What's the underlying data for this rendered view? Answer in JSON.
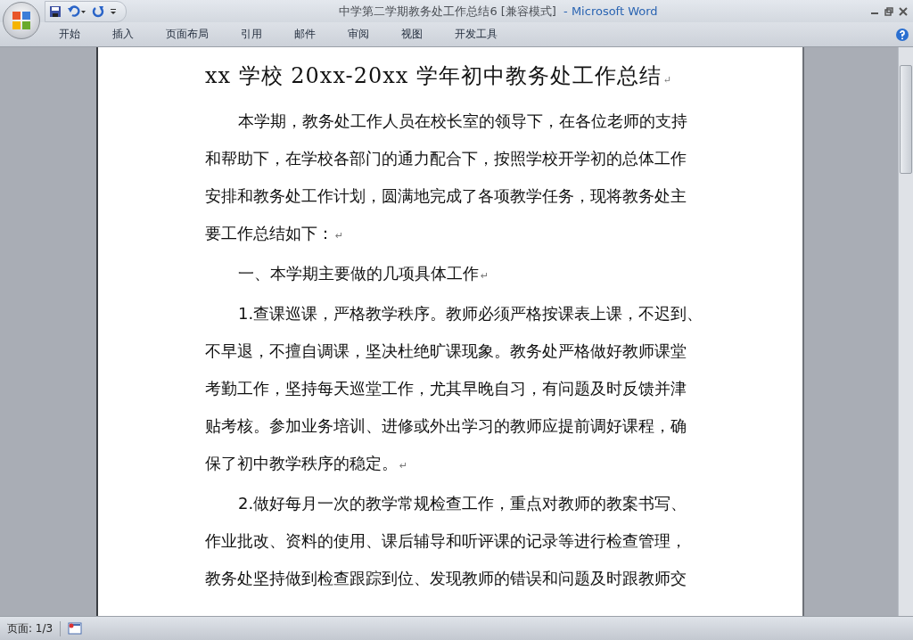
{
  "window": {
    "title": "中学第二学期教务处工作总结6 [兼容模式]",
    "app": "- Microsoft Word"
  },
  "ribbon_tabs": [
    {
      "label": "开始",
      "selected": false
    },
    {
      "label": "插入",
      "selected": false
    },
    {
      "label": "页面布局",
      "selected": false
    },
    {
      "label": "引用",
      "selected": false
    },
    {
      "label": "邮件",
      "selected": false
    },
    {
      "label": "审阅",
      "selected": false
    },
    {
      "label": "视图",
      "selected": false
    },
    {
      "label": "开发工具",
      "selected": false
    }
  ],
  "document": {
    "title": "xx 学校 20xx-20xx 学年初中教务处工作总结",
    "title_end_mark": "↵",
    "paragraphs": [
      {
        "lines": [
          "本学期，教务处工作人员在校长室的领导下，在各位老师的支持",
          "和帮助下，在学校各部门的通力配合下，按照学校开学初的总体工作",
          "安排和教务处工作计划，圆满地完成了各项教学任务，现将教务处主",
          "要工作总结如下："
        ],
        "end_mark": "↵"
      },
      {
        "lines": [
          "一、本学期主要做的几项具体工作"
        ],
        "end_mark": "↵"
      },
      {
        "lines": [
          "1.查课巡课，严格教学秩序。教师必须严格按课表上课，不迟到、",
          "不早退，不擅自调课，坚决杜绝旷课现象。教务处严格做好教师课堂",
          "考勤工作，坚持每天巡堂工作，尤其早晚自习，有问题及时反馈并津",
          "贴考核。参加业务培训、进修或外出学习的教师应提前调好课程，确",
          "保了初中教学秩序的稳定。"
        ],
        "end_mark": "↵"
      },
      {
        "lines": [
          "2.做好每月一次的教学常规检查工作，重点对教师的教案书写、",
          "作业批改、资料的使用、课后辅导和听评课的记录等进行检查管理，",
          "教务处坚持做到检查跟踪到位、发现教师的错误和问题及时跟教师交"
        ]
      }
    ]
  },
  "status_bar": {
    "page": "页面: 1/3"
  }
}
